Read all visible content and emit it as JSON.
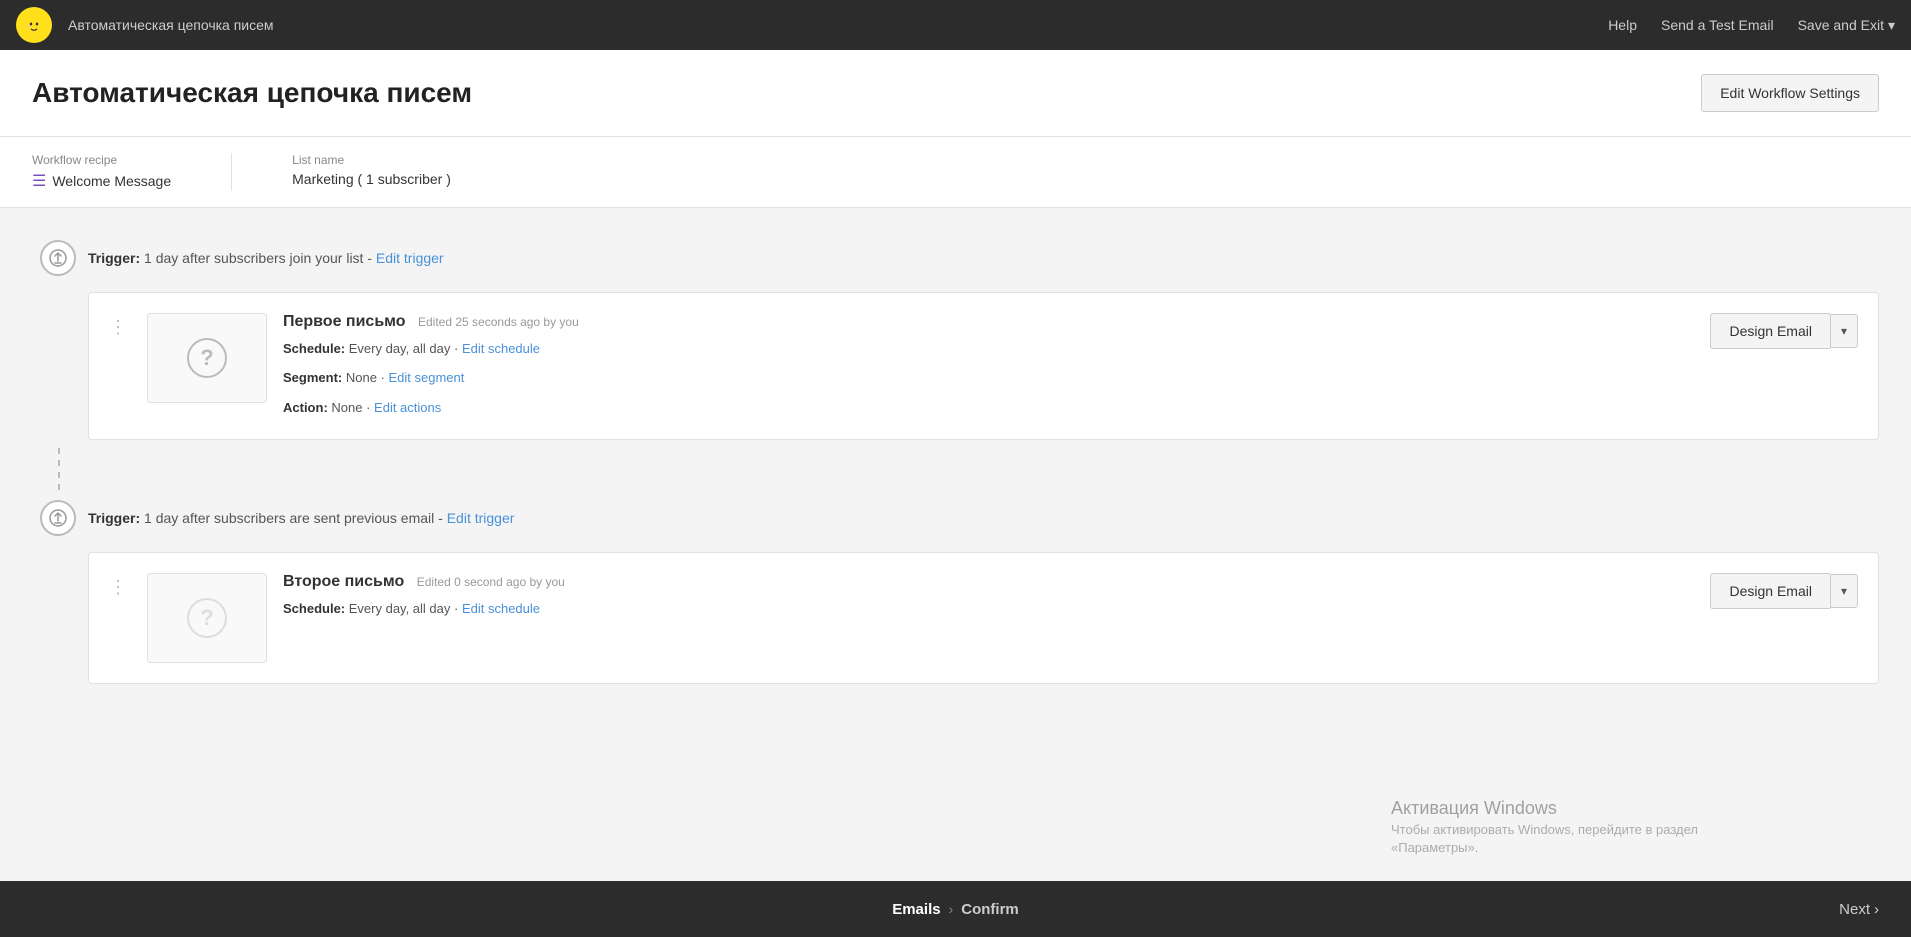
{
  "navbar": {
    "title": "Автоматическая цепочка писем",
    "help_label": "Help",
    "test_email_label": "Send a Test Email",
    "save_exit_label": "Save and Exit",
    "save_exit_chevron": "▾"
  },
  "page_header": {
    "title": "Автоматическая цепочка писем",
    "edit_workflow_btn": "Edit Workflow Settings"
  },
  "meta_bar": {
    "workflow_recipe_label": "Workflow recipe",
    "workflow_recipe_value": "Welcome Message",
    "list_name_label": "List name",
    "list_name_value": "Marketing ( 1 subscriber )"
  },
  "email_blocks": [
    {
      "trigger_label": "Trigger:",
      "trigger_text": "1 day after subscribers join your list -",
      "trigger_link": "Edit trigger",
      "email_name": "Первое письмо",
      "email_edited": "Edited 25 seconds ago by you",
      "schedule_label": "Schedule:",
      "schedule_value": "Every day, all day",
      "schedule_link": "Edit schedule",
      "segment_label": "Segment:",
      "segment_value": "None",
      "segment_link": "Edit segment",
      "action_label": "Action:",
      "action_value": "None",
      "action_link": "Edit actions",
      "design_email_btn": "Design Email",
      "dropdown_char": "▾"
    },
    {
      "trigger_label": "Trigger:",
      "trigger_text": "1 day after subscribers are sent previous email -",
      "trigger_link": "Edit trigger",
      "email_name": "Второе письмо",
      "email_edited": "Edited 0 second ago by you",
      "schedule_label": "Schedule:",
      "schedule_value": "Every day, all day",
      "schedule_link": "Edit schedule",
      "segment_label": "",
      "segment_value": "",
      "segment_link": "",
      "action_label": "",
      "action_value": "",
      "action_link": "",
      "design_email_btn": "Design Email",
      "dropdown_char": "▾"
    }
  ],
  "windows_watermark": {
    "title": "Активация Windows",
    "subtitle": "Чтобы активировать Windows, перейдите в раздел «Параметры»."
  },
  "bottom_bar": {
    "step1": "Emails",
    "chevron": "›",
    "step2": "Confirm",
    "next_label": "Next",
    "next_chevron": "›"
  }
}
